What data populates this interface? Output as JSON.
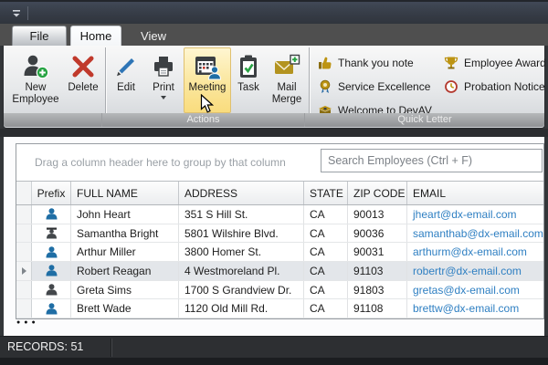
{
  "titlebar": {
    "qat_icon": "chevron-down-icon"
  },
  "tabs": [
    {
      "label": "File"
    },
    {
      "label": "Home",
      "selected": true
    },
    {
      "label": "View"
    }
  ],
  "ribbon": {
    "groups": [
      {
        "caption": "",
        "buttons": [
          {
            "label": "New Employee",
            "icon": "person-add-icon"
          },
          {
            "label": "Delete",
            "icon": "delete-x-icon"
          }
        ]
      },
      {
        "caption": "Actions",
        "buttons": [
          {
            "label": "Edit",
            "icon": "pencil-icon"
          },
          {
            "label": "Print",
            "icon": "printer-icon",
            "has_dropdown": true
          },
          {
            "label": "Meeting",
            "icon": "calendar-person-icon",
            "highlighted": true
          },
          {
            "label": "Task",
            "icon": "clipboard-check-icon"
          },
          {
            "label": "Mail Merge",
            "icon": "mail-plus-icon"
          }
        ]
      },
      {
        "caption": "Quick Letter",
        "items": [
          {
            "label": "Thank you note",
            "icon": "thumbs-up-icon"
          },
          {
            "label": "Employee Award",
            "icon": "trophy-icon"
          },
          {
            "label": "Service Excellence",
            "icon": "medal-icon"
          },
          {
            "label": "Probation Notice",
            "icon": "clock-icon"
          },
          {
            "label": "Welcome to DevAV",
            "icon": "welcome-gift-icon"
          }
        ]
      }
    ]
  },
  "grid": {
    "group_panel_text": "Drag a column header here to group by that column",
    "search_placeholder": "Search Employees (Ctrl + F)",
    "columns": [
      "Prefix",
      "FULL NAME",
      "ADDRESS",
      "STATE",
      "ZIP CODE",
      "EMAIL"
    ],
    "rows": [
      {
        "prefix_icon": "male-person-icon",
        "full_name": "John Heart",
        "address": "351 S Hill St.",
        "state": "CA",
        "zip": "90013",
        "email": "jheart@dx-email.com"
      },
      {
        "prefix_icon": "doctor-person-icon",
        "full_name": "Samantha Bright",
        "address": "5801 Wilshire Blvd.",
        "state": "CA",
        "zip": "90036",
        "email": "samanthab@dx-email.com"
      },
      {
        "prefix_icon": "male-person-icon",
        "full_name": "Arthur Miller",
        "address": "3800 Homer St.",
        "state": "CA",
        "zip": "90031",
        "email": "arthurm@dx-email.com"
      },
      {
        "prefix_icon": "male-person-icon",
        "full_name": "Robert Reagan",
        "address": "4 Westmoreland Pl.",
        "state": "CA",
        "zip": "91103",
        "email": "robertr@dx-email.com",
        "selected": true
      },
      {
        "prefix_icon": "female-person-icon",
        "full_name": "Greta Sims",
        "address": "1700 S Grandview Dr.",
        "state": "CA",
        "zip": "91803",
        "email": "gretas@dx-email.com"
      },
      {
        "prefix_icon": "male-person-icon",
        "full_name": "Brett Wade",
        "address": "1120 Old Mill Rd.",
        "state": "CA",
        "zip": "91108",
        "email": "brettw@dx-email.com"
      }
    ],
    "pager_dots": "●●●"
  },
  "statusbar": {
    "records_label": "RECORDS: 51"
  },
  "colors": {
    "accent_highlight": "#fbe9a6",
    "email_link": "#2e7fc2",
    "male_icon": "#1f6ea5",
    "female_icon": "#43474b",
    "gold_icon": "#bd9413",
    "delete_red": "#c0392b",
    "green_plus": "#27a343"
  }
}
